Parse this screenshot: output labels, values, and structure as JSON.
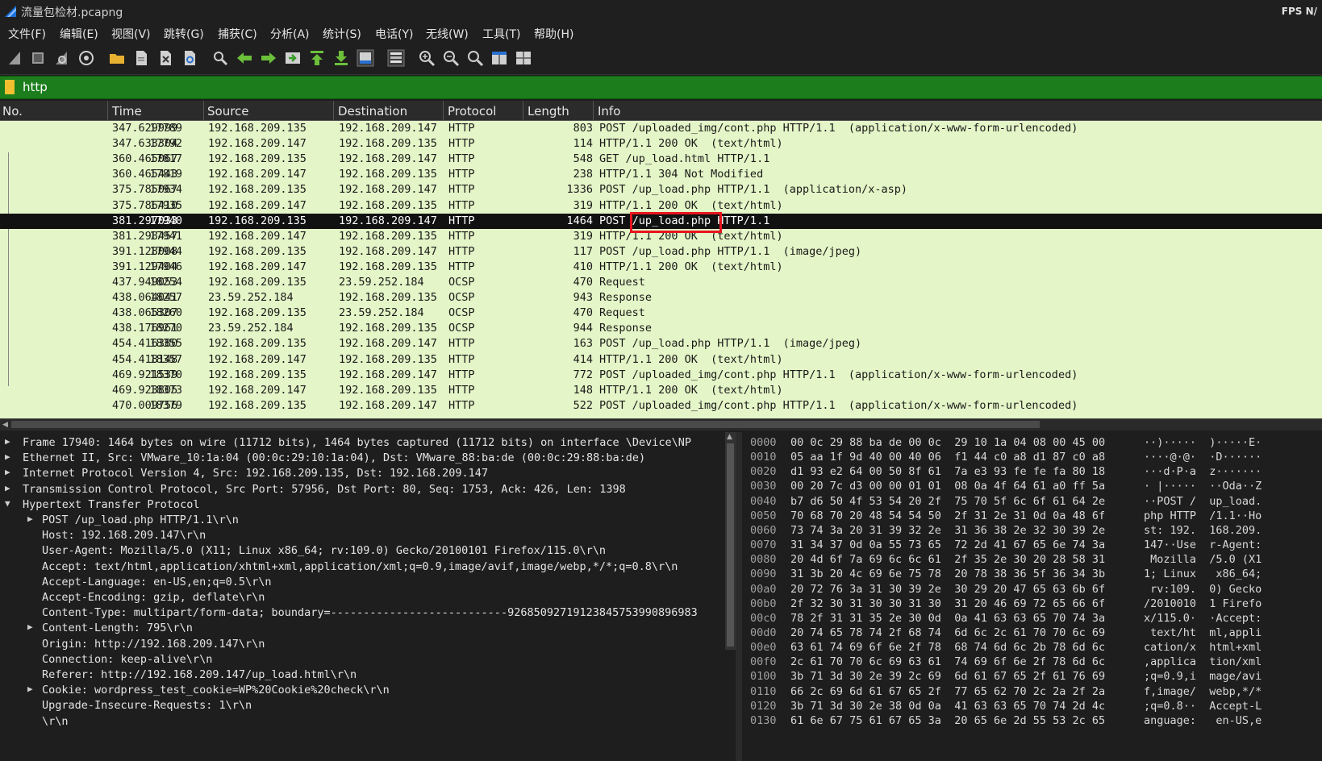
{
  "window": {
    "title": "流量包检材.pcapng",
    "fps_label": "FPS N/"
  },
  "menu": [
    "文件(F)",
    "编辑(E)",
    "视图(V)",
    "跳转(G)",
    "捕获(C)",
    "分析(A)",
    "统计(S)",
    "电话(Y)",
    "无线(W)",
    "工具(T)",
    "帮助(H)"
  ],
  "toolbar": [
    "shark-fin-start-icon",
    "stop-icon",
    "restart-icon",
    "options-gear-icon",
    "open-folder-icon",
    "save-file-icon",
    "close-file-icon",
    "reload-icon",
    "find-packet-icon",
    "back-arrow-icon",
    "forward-arrow-icon",
    "go-to-packet-icon",
    "first-packet-icon",
    "last-packet-icon",
    "autoscroll-icon",
    "colorize-icon",
    "zoom-in-icon",
    "zoom-out-icon",
    "normal-size-icon",
    "resize-columns-icon",
    "layout-icon"
  ],
  "filter": {
    "value": "http"
  },
  "packet_list": {
    "columns": [
      "No.",
      "Time",
      "Source",
      "Destination",
      "Protocol",
      "Length",
      "Info"
    ],
    "rows": [
      {
        "no": "17789",
        "time": "347.629999",
        "src": "192.168.209.135",
        "dst": "192.168.209.147",
        "proto": "HTTP",
        "len": "803",
        "info": "POST /uploaded_img/cont.php HTTP/1.1  (application/x-www-form-urlencoded)"
      },
      {
        "no": "17792",
        "time": "347.633304",
        "src": "192.168.209.147",
        "dst": "192.168.209.135",
        "proto": "HTTP",
        "len": "114",
        "info": "HTTP/1.1 200 OK  (text/html)"
      },
      {
        "no": "17817",
        "time": "360.465067",
        "src": "192.168.209.135",
        "dst": "192.168.209.147",
        "proto": "HTTP",
        "len": "548",
        "info": "GET /up_load.html HTTP/1.1"
      },
      {
        "no": "17819",
        "time": "360.465443",
        "src": "192.168.209.147",
        "dst": "192.168.209.135",
        "proto": "HTTP",
        "len": "238",
        "info": "HTTP/1.1 304 Not Modified"
      },
      {
        "no": "17934",
        "time": "375.785067",
        "src": "192.168.209.135",
        "dst": "192.168.209.147",
        "proto": "HTTP",
        "len": "1336",
        "info": "POST /up_load.php HTTP/1.1  (application/x-asp)"
      },
      {
        "no": "17935",
        "time": "375.786410",
        "src": "192.168.209.147",
        "dst": "192.168.209.135",
        "proto": "HTTP",
        "len": "319",
        "info": "HTTP/1.1 200 OK  (text/html)"
      },
      {
        "no": "17940",
        "time": "381.297033",
        "src": "192.168.209.135",
        "dst": "192.168.209.147",
        "proto": "HTTP",
        "len": "1464",
        "info": "POST /up_load.php HTTP/1.1"
      },
      {
        "no": "17941",
        "time": "381.298457",
        "src": "192.168.209.147",
        "dst": "192.168.209.135",
        "proto": "HTTP",
        "len": "319",
        "info": "HTTP/1.1 200 OK  (text/html)"
      },
      {
        "no": "17944",
        "time": "391.128008",
        "src": "192.168.209.135",
        "dst": "192.168.209.147",
        "proto": "HTTP",
        "len": "117",
        "info": "POST /up_load.php HTTP/1.1  (image/jpeg)"
      },
      {
        "no": "17946",
        "time": "391.129404",
        "src": "192.168.209.147",
        "dst": "192.168.209.135",
        "proto": "HTTP",
        "len": "410",
        "info": "HTTP/1.1 200 OK  (text/html)"
      },
      {
        "no": "18254",
        "time": "437.949053",
        "src": "192.168.209.135",
        "dst": "23.59.252.184",
        "proto": "OCSP",
        "len": "470",
        "info": "Request"
      },
      {
        "no": "18257",
        "time": "438.064041",
        "src": "23.59.252.184",
        "dst": "192.168.209.135",
        "proto": "OCSP",
        "len": "943",
        "info": "Response"
      },
      {
        "no": "18260",
        "time": "438.065307",
        "src": "192.168.209.135",
        "dst": "23.59.252.184",
        "proto": "OCSP",
        "len": "470",
        "info": "Request"
      },
      {
        "no": "18270",
        "time": "438.176961",
        "src": "23.59.252.184",
        "dst": "192.168.209.135",
        "proto": "OCSP",
        "len": "944",
        "info": "Response"
      },
      {
        "no": "18355",
        "time": "454.416380",
        "src": "192.168.209.135",
        "dst": "192.168.209.147",
        "proto": "HTTP",
        "len": "163",
        "info": "POST /up_load.php HTTP/1.1  (image/jpeg)"
      },
      {
        "no": "18357",
        "time": "454.418148",
        "src": "192.168.209.147",
        "dst": "192.168.209.135",
        "proto": "HTTP",
        "len": "414",
        "info": "HTTP/1.1 200 OK  (text/html)"
      },
      {
        "no": "18370",
        "time": "469.921539",
        "src": "192.168.209.135",
        "dst": "192.168.209.147",
        "proto": "HTTP",
        "len": "772",
        "info": "POST /uploaded_img/cont.php HTTP/1.1  (application/x-www-form-urlencoded)"
      },
      {
        "no": "18373",
        "time": "469.923805",
        "src": "192.168.209.147",
        "dst": "192.168.209.135",
        "proto": "HTTP",
        "len": "148",
        "info": "HTTP/1.1 200 OK  (text/html)"
      },
      {
        "no": "18379",
        "time": "470.009756",
        "src": "192.168.209.135",
        "dst": "192.168.209.147",
        "proto": "HTTP",
        "len": "522",
        "info": "POST /uploaded_img/cont.php HTTP/1.1  (application/x-www-form-urlencoded)"
      }
    ],
    "selected_no": "17940"
  },
  "details": {
    "top_items": [
      "Frame 17940: 1464 bytes on wire (11712 bits), 1464 bytes captured (11712 bits) on interface \\Device\\NP",
      "Ethernet II, Src: VMware_10:1a:04 (00:0c:29:10:1a:04), Dst: VMware_88:ba:de (00:0c:29:88:ba:de)",
      "Internet Protocol Version 4, Src: 192.168.209.135, Dst: 192.168.209.147",
      "Transmission Control Protocol, Src Port: 57956, Dst Port: 80, Seq: 1753, Ack: 426, Len: 1398",
      "Hypertext Transfer Protocol"
    ],
    "http_items": [
      "POST /up_load.php HTTP/1.1\\r\\n",
      "Host: 192.168.209.147\\r\\n",
      "User-Agent: Mozilla/5.0 (X11; Linux x86_64; rv:109.0) Gecko/20100101 Firefox/115.0\\r\\n",
      "Accept: text/html,application/xhtml+xml,application/xml;q=0.9,image/avif,image/webp,*/*;q=0.8\\r\\n",
      "Accept-Language: en-US,en;q=0.5\\r\\n",
      "Accept-Encoding: gzip, deflate\\r\\n",
      "Content-Type: multipart/form-data; boundary=---------------------------92685092719123845753990896983",
      "Content-Length: 795\\r\\n",
      "Origin: http://192.168.209.147\\r\\n",
      "Connection: keep-alive\\r\\n",
      "Referer: http://192.168.209.147/up_load.html\\r\\n",
      "Cookie: wordpress_test_cookie=WP%20Cookie%20check\\r\\n",
      "Upgrade-Insecure-Requests: 1\\r\\n",
      "\\r\\n"
    ]
  },
  "bytes": [
    {
      "off": "0000",
      "hex": "00 0c 29 88 ba de 00 0c  29 10 1a 04 08 00 45 00",
      "ascii": "··)·····  )·····E·"
    },
    {
      "off": "0010",
      "hex": "05 aa 1f 9d 40 00 40 06  f1 44 c0 a8 d1 87 c0 a8",
      "ascii": "····@·@·  ·D······"
    },
    {
      "off": "0020",
      "hex": "d1 93 e2 64 00 50 8f 61  7a e3 93 fe fe fa 80 18",
      "ascii": "···d·P·a  z·······"
    },
    {
      "off": "0030",
      "hex": "00 20 7c d3 00 00 01 01  08 0a 4f 64 61 a0 ff 5a",
      "ascii": "· |·····  ··Oda··Z"
    },
    {
      "off": "0040",
      "hex": "b7 d6 50 4f 53 54 20 2f  75 70 5f 6c 6f 61 64 2e",
      "ascii": "··POST /  up_load."
    },
    {
      "off": "0050",
      "hex": "70 68 70 20 48 54 54 50  2f 31 2e 31 0d 0a 48 6f",
      "ascii": "php HTTP  /1.1··Ho"
    },
    {
      "off": "0060",
      "hex": "73 74 3a 20 31 39 32 2e  31 36 38 2e 32 30 39 2e",
      "ascii": "st: 192.  168.209."
    },
    {
      "off": "0070",
      "hex": "31 34 37 0d 0a 55 73 65  72 2d 41 67 65 6e 74 3a",
      "ascii": "147··Use  r-Agent:"
    },
    {
      "off": "0080",
      "hex": "20 4d 6f 7a 69 6c 6c 61  2f 35 2e 30 20 28 58 31",
      "ascii": " Mozilla  /5.0 (X1"
    },
    {
      "off": "0090",
      "hex": "31 3b 20 4c 69 6e 75 78  20 78 38 36 5f 36 34 3b",
      "ascii": "1; Linux   x86_64;"
    },
    {
      "off": "00a0",
      "hex": "20 72 76 3a 31 30 39 2e  30 29 20 47 65 63 6b 6f",
      "ascii": " rv:109.  0) Gecko"
    },
    {
      "off": "00b0",
      "hex": "2f 32 30 31 30 30 31 30  31 20 46 69 72 65 66 6f",
      "ascii": "/2010010  1 Firefo"
    },
    {
      "off": "00c0",
      "hex": "78 2f 31 31 35 2e 30 0d  0a 41 63 63 65 70 74 3a",
      "ascii": "x/115.0·  ·Accept:"
    },
    {
      "off": "00d0",
      "hex": "20 74 65 78 74 2f 68 74  6d 6c 2c 61 70 70 6c 69",
      "ascii": " text/ht  ml,appli"
    },
    {
      "off": "00e0",
      "hex": "63 61 74 69 6f 6e 2f 78  68 74 6d 6c 2b 78 6d 6c",
      "ascii": "cation/x  html+xml"
    },
    {
      "off": "00f0",
      "hex": "2c 61 70 70 6c 69 63 61  74 69 6f 6e 2f 78 6d 6c",
      "ascii": ",applica  tion/xml"
    },
    {
      "off": "0100",
      "hex": "3b 71 3d 30 2e 39 2c 69  6d 61 67 65 2f 61 76 69",
      "ascii": ";q=0.9,i  mage/avi"
    },
    {
      "off": "0110",
      "hex": "66 2c 69 6d 61 67 65 2f  77 65 62 70 2c 2a 2f 2a",
      "ascii": "f,image/  webp,*/*"
    },
    {
      "off": "0120",
      "hex": "3b 71 3d 30 2e 38 0d 0a  41 63 63 65 70 74 2d 4c",
      "ascii": ";q=0.8··  Accept-L"
    },
    {
      "off": "0130",
      "hex": "61 6e 67 75 61 67 65 3a  20 65 6e 2d 55 53 2c 65",
      "ascii": "anguage:   en-US,e"
    }
  ],
  "colors": {
    "accent_red": "#e8141d",
    "filter_green": "#1b7d1b",
    "row_green": "#e4f5c7"
  }
}
